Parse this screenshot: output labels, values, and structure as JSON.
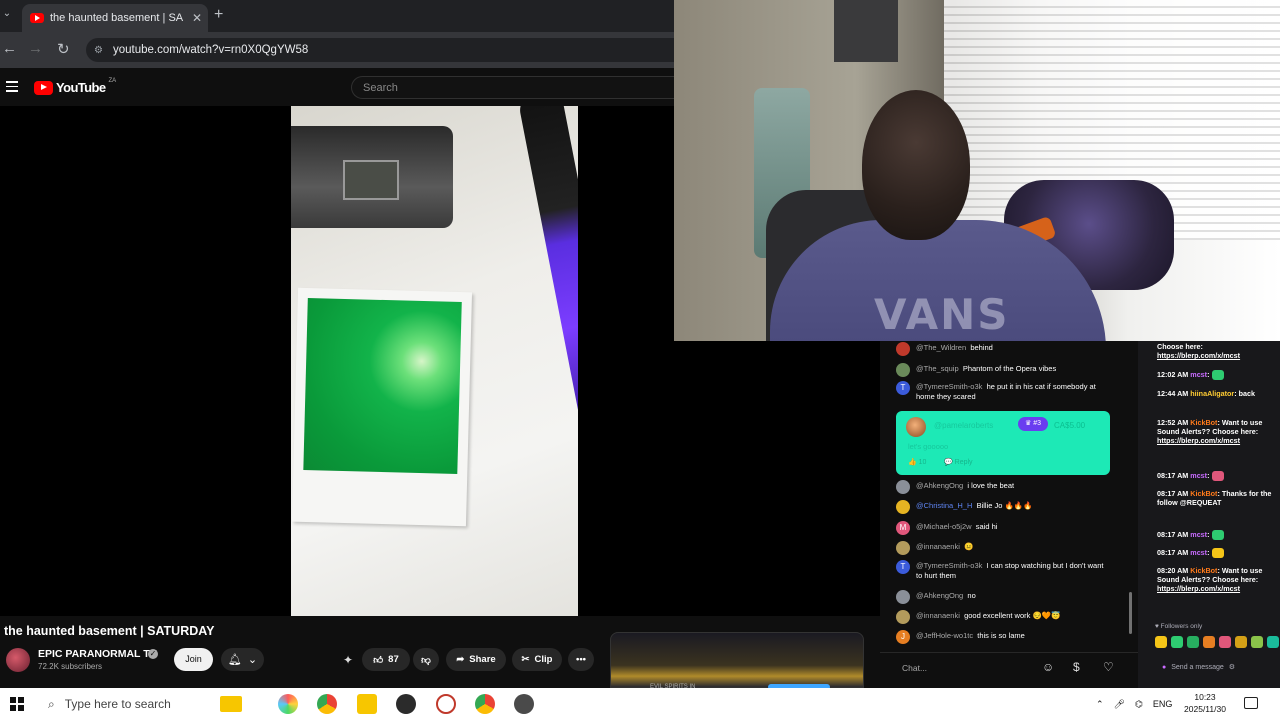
{
  "browser": {
    "tab_title": "the haunted basement | SA",
    "new_tab": "+",
    "tab_close": "✕",
    "tab_list": "⌄",
    "url": "youtube.com/watch?v=rn0X0QgYW58",
    "back": "←",
    "forward": "→",
    "reload": "↻"
  },
  "youtube": {
    "logo_text": "YouTube",
    "country_code": "ZA",
    "search_placeholder": "Search"
  },
  "video": {
    "title": "the haunted basement | SATURDAY",
    "channel": "EPIC PARANORMAL TV",
    "subscribers": "72.2K subscribers",
    "join_label": "Join",
    "like_count": "87",
    "share_label": "Share",
    "clip_label": "Clip",
    "more": "•••",
    "suggested_label": "EVIL SPIRITS IN"
  },
  "chat": {
    "messages": [
      {
        "name": "@The_Wildren",
        "text": "behind",
        "avatar_color": "#c0392b"
      },
      {
        "name": "@The_squip",
        "text": "Phantom of the Opera vibes",
        "avatar_color": "#6a8a5a"
      },
      {
        "name": "@TymereSmith-o3k",
        "text": "he put it in his cat if somebody at home they scared",
        "avatar_color": "#3b5bdb",
        "avatar_letter": "T"
      },
      {
        "name": "@AhkengOng",
        "text": "i love the beat",
        "avatar_color": "#8a8f98"
      },
      {
        "name": "@Christina_H_H",
        "text": "Billie Jo 🔥🔥🔥",
        "avatar_color": "#e6b422",
        "name_color": "#5e84f1"
      },
      {
        "name": "@Michael-o5j2w",
        "text": "said hi",
        "avatar_color": "#e0577b",
        "avatar_letter": "M"
      },
      {
        "name": "@innanaenki",
        "text": "😐",
        "avatar_color": "#b39b5c"
      },
      {
        "name": "@TymereSmith-o3k",
        "text": "I can stop watching but I don't want to hurt them",
        "avatar_color": "#3b5bdb",
        "avatar_letter": "T"
      },
      {
        "name": "@AhkengOng",
        "text": "no",
        "avatar_color": "#8a8f98"
      },
      {
        "name": "@innanaenki",
        "text": "good excellent work 😔🧡😇",
        "avatar_color": "#b39b5c"
      },
      {
        "name": "@JeffHole-wo1tc",
        "text": "this is so lame",
        "avatar_color": "#e67e22",
        "avatar_letter": "J"
      }
    ],
    "superchat": {
      "name": "@pamelaroberts",
      "badge": "♛ #3",
      "amount": "CA$5.00",
      "message": "let's gooooo",
      "likes": "👍 10",
      "reply": "💬 Reply"
    },
    "input_placeholder": "Chat...",
    "emoji_icon": "☺",
    "money_icon": "$",
    "heart_icon": "♡"
  },
  "stream_chat": {
    "lines": [
      {
        "time": "",
        "user": "",
        "text": "Choose here:",
        "link": "https://blerp.com/x/mcst"
      },
      {
        "time": "12:02 AM",
        "user": "mcst",
        "text": ":",
        "link": ""
      },
      {
        "time": "12:44 AM",
        "user": "hiinaAligator",
        "text": ": back",
        "link": ""
      },
      {
        "time": "12:52 AM",
        "user": "KickBot",
        "text": ": Want to use Sound Alerts?? Choose here:",
        "link": "https://blerp.com/x/mcst"
      },
      {
        "time": "08:17 AM",
        "user": "mcst",
        "text": ":",
        "link": ""
      },
      {
        "time": "08:17 AM",
        "user": "KickBot",
        "text": ": Thanks for the follow @REQUEAT",
        "link": ""
      },
      {
        "time": "08:17 AM",
        "user": "mcst",
        "text": ":",
        "link": ""
      },
      {
        "time": "08:17 AM",
        "user": "mcst",
        "text": ":",
        "link": ""
      },
      {
        "time": "08:20 AM",
        "user": "KickBot",
        "text": ": Want to use Sound Alerts?? Choose here:",
        "link": "https://blerp.com/x/mcst"
      }
    ],
    "followers_only": "♥ Followers only",
    "send_placeholder": "Send a message"
  },
  "taskbar": {
    "search_placeholder": "Type here to search",
    "language": "ENG",
    "time": "10:23",
    "date": "2025/11/30"
  }
}
